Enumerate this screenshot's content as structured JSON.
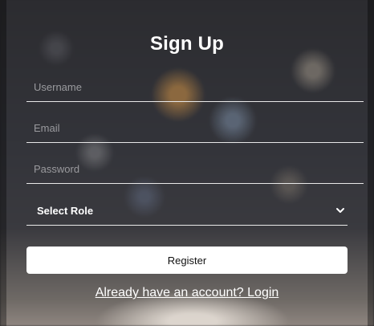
{
  "form": {
    "title": "Sign Up",
    "username_placeholder": "Username",
    "email_placeholder": "Email",
    "password_placeholder": "Password",
    "role_select_value": "Select Role",
    "register_label": "Register",
    "login_link": "Already have an account? Login"
  },
  "icons": {
    "role_select": "chevron-down-icon"
  },
  "colors": {
    "text": "#ffffff",
    "button_bg": "#ffffff",
    "button_text": "#111111",
    "placeholder": "#9a9a9e"
  }
}
